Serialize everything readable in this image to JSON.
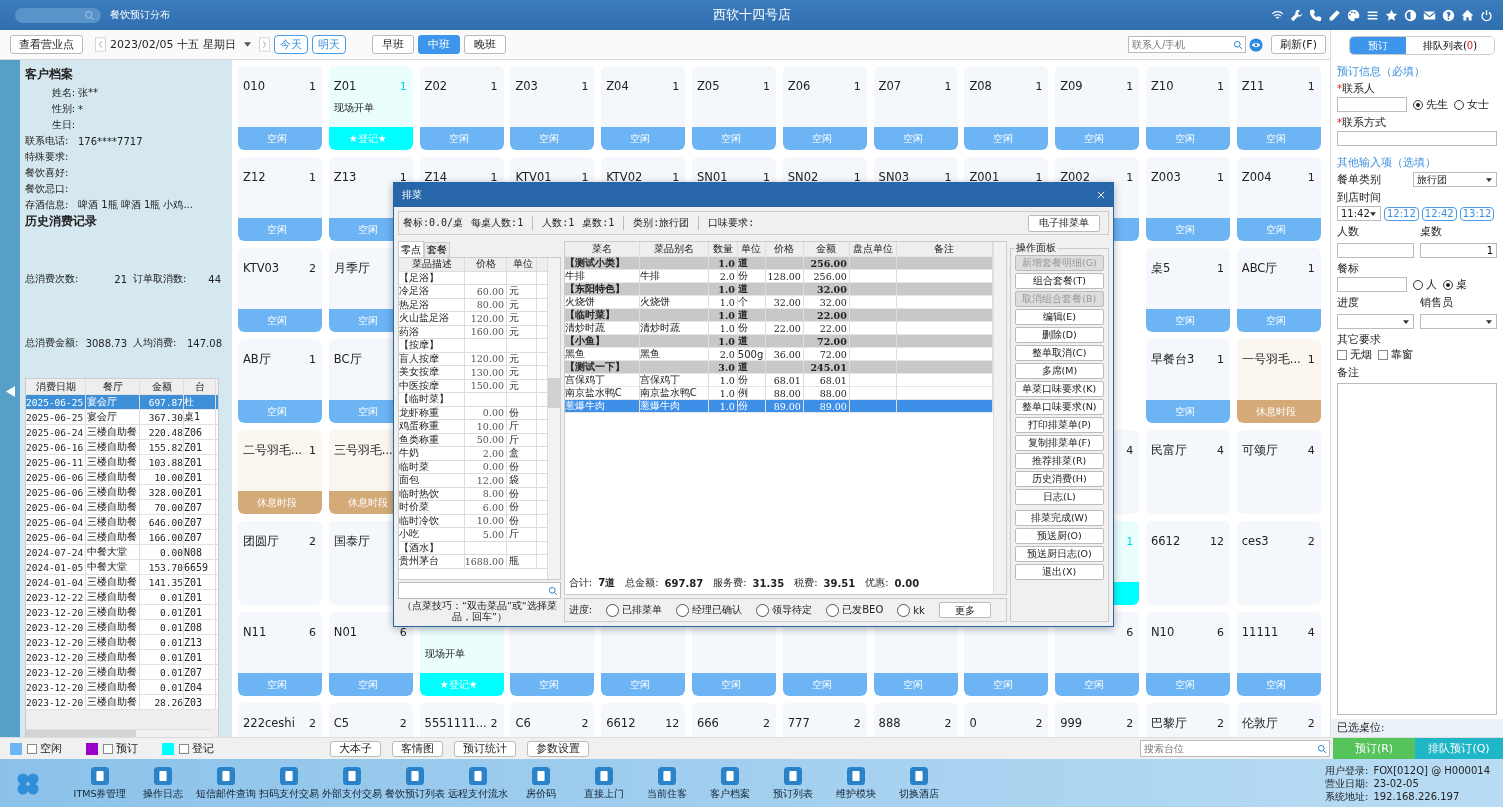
{
  "topbar": {
    "module": "餐饮预订分布",
    "title": "西软十四号店"
  },
  "toolbar": {
    "view_button": "查看营业点",
    "date": "2023/02/05",
    "lunar": "十五",
    "weekday": "星期日",
    "today": "今天",
    "tomorrow": "明天",
    "shifts": [
      {
        "label": "早班",
        "selected": false
      },
      {
        "label": "中班",
        "selected": true
      },
      {
        "label": "晚班",
        "selected": false
      }
    ],
    "search_placeholder": "联系人/手机",
    "refresh": "刷新(F)"
  },
  "customer": {
    "title": "客户档案",
    "fields": [
      {
        "label": "姓名:",
        "value": "张**"
      },
      {
        "label": "性别:",
        "value": "*"
      },
      {
        "label": "生日:"
      },
      {
        "label": "联系电话:",
        "value": "176****7717"
      },
      {
        "label": "特殊要求:"
      },
      {
        "label": "餐饮喜好:"
      },
      {
        "label": "餐饮忌口:"
      },
      {
        "label": "存酒信息:",
        "value": "啤酒 1瓶  啤酒 1瓶  小鸡..."
      }
    ],
    "history_title": "历史消费记录",
    "stats": [
      [
        {
          "label": "总消费次数:",
          "value": "21"
        },
        {
          "label": "订单取消数:",
          "value": "44"
        }
      ],
      [
        {
          "label": "总消费金额:",
          "value": "3088.73"
        },
        {
          "label": "人均消费:",
          "value": "147.08"
        }
      ]
    ],
    "history": {
      "columns": [
        "消费日期",
        "餐厅",
        "金额",
        "台"
      ],
      "rows": [
        {
          "date": "2025-06-25",
          "hall": "宴会厅",
          "amount": "697.87",
          "table": "杜",
          "selected": true
        },
        {
          "date": "2025-06-25",
          "hall": "宴会厅",
          "amount": "367.30",
          "table": "桌1",
          "selected": false
        },
        {
          "date": "2025-06-24",
          "hall": "三楼自助餐",
          "amount": "220.48",
          "table": "Z06",
          "selected": false
        },
        {
          "date": "2025-06-16",
          "hall": "三楼自助餐",
          "amount": "155.82",
          "table": "Z01",
          "selected": false
        },
        {
          "date": "2025-06-11",
          "hall": "三楼自助餐",
          "amount": "103.88",
          "table": "Z01",
          "selected": false
        },
        {
          "date": "2025-06-06",
          "hall": "三楼自助餐",
          "amount": "10.00",
          "table": "Z01",
          "selected": false
        },
        {
          "date": "2025-06-06",
          "hall": "三楼自助餐",
          "amount": "328.00",
          "table": "Z01",
          "selected": false
        },
        {
          "date": "2025-06-04",
          "hall": "三楼自助餐",
          "amount": "70.00",
          "table": "Z07",
          "selected": false
        },
        {
          "date": "2025-06-04",
          "hall": "三楼自助餐",
          "amount": "646.00",
          "table": "Z07",
          "selected": false
        },
        {
          "date": "2025-06-04",
          "hall": "三楼自助餐",
          "amount": "166.00",
          "table": "Z07",
          "selected": false
        },
        {
          "date": "2024-07-24",
          "hall": "中餐大堂",
          "amount": "0.00",
          "table": "N08",
          "selected": false
        },
        {
          "date": "2024-01-05",
          "hall": "中餐大堂",
          "amount": "153.70",
          "table": "6659",
          "selected": false
        },
        {
          "date": "2024-01-04",
          "hall": "三楼自助餐",
          "amount": "141.35",
          "table": "Z01",
          "selected": false
        },
        {
          "date": "2023-12-22",
          "hall": "三楼自助餐",
          "amount": "0.01",
          "table": "Z01",
          "selected": false
        },
        {
          "date": "2023-12-20",
          "hall": "三楼自助餐",
          "amount": "0.01",
          "table": "Z01",
          "selected": false
        },
        {
          "date": "2023-12-20",
          "hall": "三楼自助餐",
          "amount": "0.01",
          "table": "Z08",
          "selected": false
        },
        {
          "date": "2023-12-20",
          "hall": "三楼自助餐",
          "amount": "0.01",
          "table": "Z13",
          "selected": false
        },
        {
          "date": "2023-12-20",
          "hall": "三楼自助餐",
          "amount": "0.01",
          "table": "Z01",
          "selected": false
        },
        {
          "date": "2023-12-20",
          "hall": "三楼自助餐",
          "amount": "0.01",
          "table": "Z07",
          "selected": false
        },
        {
          "date": "2023-12-20",
          "hall": "三楼自助餐",
          "amount": "0.01",
          "table": "Z04",
          "selected": false
        },
        {
          "date": "2023-12-20",
          "hall": "三楼自助餐",
          "amount": "28.26",
          "table": "Z03",
          "selected": false
        }
      ]
    }
  },
  "tables": [
    {
      "label": "010",
      "count": "1",
      "status": {
        "kind": "free",
        "text": "空闲"
      }
    },
    {
      "label": "Z01",
      "count": "1",
      "note": "现场开单",
      "status": {
        "kind": "registered",
        "text": "★登记★"
      }
    },
    {
      "label": "Z02",
      "count": "1",
      "status": {
        "kind": "free",
        "text": "空闲"
      }
    },
    {
      "label": "Z03",
      "count": "1",
      "status": {
        "kind": "free",
        "text": "空闲"
      }
    },
    {
      "label": "Z04",
      "count": "1",
      "status": {
        "kind": "free",
        "text": "空闲"
      }
    },
    {
      "label": "Z05",
      "count": "1",
      "status": {
        "kind": "free",
        "text": "空闲"
      }
    },
    {
      "label": "Z06",
      "count": "1",
      "status": {
        "kind": "free",
        "text": "空闲"
      }
    },
    {
      "label": "Z07",
      "count": "1",
      "status": {
        "kind": "free",
        "text": "空闲"
      }
    },
    {
      "label": "Z08",
      "count": "1",
      "status": {
        "kind": "free",
        "text": "空闲"
      }
    },
    {
      "label": "Z09",
      "count": "1",
      "status": {
        "kind": "free",
        "text": "空闲"
      }
    },
    {
      "label": "Z10",
      "count": "1",
      "status": {
        "kind": "free",
        "text": "空闲"
      }
    },
    {
      "label": "Z11",
      "count": "1",
      "status": {
        "kind": "free",
        "text": "空闲"
      }
    },
    {
      "label": "Z12",
      "count": "1",
      "status": {
        "kind": "free",
        "text": "空闲"
      }
    },
    {
      "label": "Z13",
      "count": "1",
      "status": {
        "kind": "free",
        "text": "空闲"
      }
    },
    {
      "label": "Z14",
      "count": "1"
    },
    {
      "label": "KTV01",
      "count": "1"
    },
    {
      "label": "KTV02",
      "count": "1"
    },
    {
      "label": "SN01",
      "count": "1"
    },
    {
      "label": "SN02",
      "count": "1"
    },
    {
      "label": "SN03",
      "count": "1"
    },
    {
      "label": "Z001",
      "count": "1"
    },
    {
      "label": "Z002",
      "count": "1",
      "status": {
        "kind": "free"
      }
    },
    {
      "label": "Z003",
      "count": "1",
      "status": {
        "kind": "free",
        "text": "空闲"
      }
    },
    {
      "label": "Z004",
      "count": "1",
      "status": {
        "kind": "free",
        "text": "空闲"
      }
    },
    {
      "label": "KTV03",
      "count": "2",
      "status": {
        "kind": "free",
        "text": "空闲"
      }
    },
    {
      "label": "月季厅",
      "status": {
        "kind": "free",
        "text": "空闲"
      }
    },
    {
      "label": "桌5",
      "count": "1",
      "status": {
        "kind": "free",
        "text": "空闲"
      }
    },
    {
      "label": "ABC厅",
      "count": "1",
      "status": {
        "kind": "free",
        "text": "空闲"
      }
    },
    {
      "label": "AB厅",
      "count": "1",
      "status": {
        "kind": "free",
        "text": "空闲"
      }
    },
    {
      "label": "BC厅",
      "status": {
        "kind": "free",
        "text": "空闲"
      }
    },
    {
      "label": "早餐台3",
      "count": "1",
      "status": {
        "kind": "free",
        "text": "空闲"
      }
    },
    {
      "label": "一号羽毛...",
      "count": "1",
      "status": {
        "kind": "rest",
        "text": "休息时段"
      }
    },
    {
      "label": "二号羽毛...",
      "count": "1",
      "status": {
        "kind": "rest",
        "text": "休息时段"
      }
    },
    {
      "label": "三号羽毛...",
      "status": {
        "kind": "rest",
        "text": "休息时段"
      }
    },
    {
      "count": "4"
    },
    {
      "label": "民富厅",
      "count": "4"
    },
    {
      "label": "可颂厅",
      "count": "4"
    },
    {
      "label": "团圆厅",
      "count": "2"
    },
    {
      "label": "国泰厅"
    },
    {
      "count": "1",
      "status": {
        "kind": "registered"
      }
    },
    {
      "label": "6612",
      "count": "12"
    },
    {
      "label": "ces3",
      "count": "2"
    },
    {
      "label": "N11",
      "count": "6",
      "status": {
        "kind": "free",
        "text": "空闲"
      }
    },
    {
      "label": "N01",
      "count": "6",
      "status": {
        "kind": "free",
        "text": "空闲"
      }
    },
    {
      "note": "现场开单",
      "status": {
        "kind": "registered",
        "text": "★登记★"
      }
    },
    {
      "status": {
        "kind": "free",
        "text": "空闲"
      }
    },
    {
      "status": {
        "kind": "free",
        "text": "空闲"
      }
    },
    {
      "status": {
        "kind": "free",
        "text": "空闲"
      }
    },
    {
      "status": {
        "kind": "free",
        "text": "空闲"
      }
    },
    {
      "status": {
        "kind": "free",
        "text": "空闲"
      }
    },
    {
      "status": {
        "kind": "free",
        "text": "空闲"
      }
    },
    {
      "count": "6",
      "status": {
        "kind": "free",
        "text": "空闲"
      }
    },
    {
      "label": "N10",
      "count": "6",
      "status": {
        "kind": "free",
        "text": "空闲"
      }
    },
    {
      "label": "11111",
      "count": "4",
      "status": {
        "kind": "free",
        "text": "空闲"
      }
    },
    {
      "label": "222ceshi",
      "count": "2"
    },
    {
      "label": "C5",
      "count": "2"
    },
    {
      "label": "5551111...",
      "count": "2"
    },
    {
      "label": "C6",
      "count": "2"
    },
    {
      "label": "6612",
      "count": "12"
    },
    {
      "label": "666",
      "count": "2"
    },
    {
      "label": "777",
      "count": "2"
    },
    {
      "label": "888",
      "count": "2"
    },
    {
      "label": "0",
      "count": "2"
    },
    {
      "label": "999",
      "count": "2"
    },
    {
      "label": "巴黎厅",
      "count": "2"
    },
    {
      "label": "伦敦厅",
      "count": "2"
    }
  ],
  "reservation": {
    "tabs": [
      {
        "label": "预订",
        "selected": true
      },
      {
        "label": "排队列表",
        "count_open": "(",
        "count": "0",
        "count_close": ")",
        "selected": false
      }
    ],
    "required_title": "预订信息（必填）",
    "mark": "*",
    "contact_label": "联系人",
    "genders": [
      {
        "label": "先生",
        "selected": true
      },
      {
        "label": "女士",
        "selected": false
      }
    ],
    "phone_label": "联系方式",
    "optional_title": "其他输入项（选填）",
    "menu_type_label": "餐单类别",
    "menu_type": "旅行团",
    "arrival_label": "到店时间",
    "arrival": "11:42",
    "quick_times": [
      "12:12",
      "12:42",
      "13:12"
    ],
    "guests_label": "人数",
    "tables_label": "桌数",
    "tables_value": "1",
    "standard_label": "餐标",
    "standard_units": [
      {
        "label": "人",
        "selected": false
      },
      {
        "label": "桌",
        "selected": true
      }
    ],
    "progress_label": "进度",
    "sales_label": "销售员",
    "other_label": "其它要求",
    "options": [
      {
        "label": "无烟",
        "checked": false
      },
      {
        "label": "靠窗",
        "checked": false
      }
    ],
    "remark_label": "备注",
    "selected_tables_label": "已选桌位:"
  },
  "bottombar": {
    "legend": [
      {
        "label": "空闲",
        "color": "#6cb4f4",
        "checked": false
      },
      {
        "label": "预订",
        "color": "#9900cc",
        "checked": false
      },
      {
        "label": "登记",
        "color": "#00ffff",
        "checked": false
      }
    ],
    "buttons": [
      "大本子",
      "客情图",
      "预订统计",
      "参数设置"
    ],
    "search_placeholder": "搜索台位",
    "reserve": "预订(R)",
    "queue": "排队预订(Q)"
  },
  "taskbar": {
    "items": [
      "ITMS券管理",
      "操作日志",
      "短信邮件查询",
      "扫码支付交易",
      "外部支付交易",
      "餐饮预订列表",
      "远程支付流水",
      "房价码",
      "直接上门",
      "当前住客",
      "客户档案",
      "预订列表",
      "维护模块",
      "切换酒店"
    ],
    "status": [
      {
        "label": "用户登录:",
        "value": "FOX[012Q] @ H000014"
      },
      {
        "label": "营业日期:",
        "value": "23-02-05"
      },
      {
        "label": "系统地址:",
        "value": "192.168.226.197"
      }
    ]
  },
  "dialog": {
    "title": "排菜",
    "info_groups": [
      [
        "餐标:0.0/桌",
        "每桌人数:1"
      ],
      [
        "人数:1",
        "桌数:1"
      ],
      [
        "类别:旅行团"
      ],
      [
        "口味要求:"
      ]
    ],
    "e_menu": "电子排菜单",
    "tabs": [
      {
        "label": "零点",
        "selected": true
      },
      {
        "label": "套餐",
        "selected": false
      }
    ],
    "menu_columns": [
      "菜品描述",
      "价格",
      "单位"
    ],
    "menu": [
      {
        "kind": "category",
        "name": "【足浴】"
      },
      {
        "kind": "item",
        "name": "冷足浴",
        "price": "60.00",
        "unit": "元"
      },
      {
        "kind": "item",
        "name": "热足浴",
        "price": "80.00",
        "unit": "元"
      },
      {
        "kind": "item",
        "name": "火山盐足浴",
        "price": "120.00",
        "unit": "元"
      },
      {
        "kind": "item",
        "name": "药浴",
        "price": "160.00",
        "unit": "元"
      },
      {
        "kind": "category",
        "name": "【按摩】"
      },
      {
        "kind": "item",
        "name": "盲人按摩",
        "price": "120.00",
        "unit": "元"
      },
      {
        "kind": "item",
        "name": "美女按摩",
        "price": "130.00",
        "unit": "元"
      },
      {
        "kind": "item",
        "name": "中医按摩",
        "price": "150.00",
        "unit": "元"
      },
      {
        "kind": "category",
        "name": "【临时菜】"
      },
      {
        "kind": "item",
        "name": "龙虾称重",
        "price": "0.00",
        "unit": "份"
      },
      {
        "kind": "item",
        "name": "鸡蛋称重",
        "price": "10.00",
        "unit": "斤"
      },
      {
        "kind": "item",
        "name": "鱼类称重",
        "price": "50.00",
        "unit": "斤"
      },
      {
        "kind": "item",
        "name": "牛奶",
        "price": "2.00",
        "unit": "盒"
      },
      {
        "kind": "item",
        "name": "临时菜",
        "price": "0.00",
        "unit": "份"
      },
      {
        "kind": "item",
        "name": "面包",
        "price": "12.00",
        "unit": "袋"
      },
      {
        "kind": "item",
        "name": "临时热饮",
        "price": "8.00",
        "unit": "份"
      },
      {
        "kind": "item",
        "name": "时价菜",
        "price": "6.00",
        "unit": "份"
      },
      {
        "kind": "item",
        "name": "临时冷饮",
        "price": "10.00",
        "unit": "份"
      },
      {
        "kind": "item",
        "name": "小吃",
        "price": "5.00",
        "unit": "斤"
      },
      {
        "kind": "category",
        "name": "【酒水】"
      },
      {
        "kind": "item",
        "name": "贵州茅台",
        "price": "1688.00",
        "unit": "瓶"
      }
    ],
    "hint": "（点菜技巧：“双击菜品”或“选择菜品，回车”）",
    "order_columns": [
      "菜名",
      "菜品别名",
      "数量",
      "单位",
      "价格",
      "金额",
      "盘点单位",
      "备注"
    ],
    "order": [
      {
        "kind": "group",
        "name": "【测试小类】",
        "qty": "1.0",
        "unit": "道",
        "amount": "256.00",
        "selected": false
      },
      {
        "kind": "item",
        "name": "牛排",
        "alias": "牛排",
        "qty": "2.0",
        "unit": "份",
        "price": "128.00",
        "amount": "256.00",
        "selected": false
      },
      {
        "kind": "group",
        "name": "【东阳特色】",
        "qty": "1.0",
        "unit": "道",
        "amount": "32.00",
        "selected": false
      },
      {
        "kind": "item",
        "name": "火烧饼",
        "alias": "火烧饼",
        "qty": "1.0",
        "unit": "个",
        "price": "32.00",
        "amount": "32.00",
        "selected": false
      },
      {
        "kind": "group",
        "name": "【临时菜】",
        "qty": "1.0",
        "unit": "道",
        "amount": "22.00",
        "selected": false
      },
      {
        "kind": "item",
        "name": "清炒时蔬",
        "alias": "清炒时蔬",
        "qty": "1.0",
        "unit": "份",
        "price": "22.00",
        "amount": "22.00",
        "selected": false
      },
      {
        "kind": "group",
        "name": "【小鱼】",
        "qty": "1.0",
        "unit": "道",
        "amount": "72.00",
        "selected": false
      },
      {
        "kind": "item",
        "name": "黑鱼",
        "alias": "黑鱼",
        "qty": "2.0",
        "unit": "500g",
        "price": "36.00",
        "amount": "72.00",
        "selected": false
      },
      {
        "kind": "group",
        "name": "【测试一下】",
        "qty": "3.0",
        "unit": "道",
        "amount": "245.01",
        "selected": false
      },
      {
        "kind": "item",
        "name": "宫保鸡丁",
        "alias": "宫保鸡丁",
        "qty": "1.0",
        "unit": "份",
        "price": "68.01",
        "amount": "68.01",
        "selected": false
      },
      {
        "kind": "item",
        "name": "南京盐水鸭C",
        "alias": "南京盐水鸭C",
        "qty": "1.0",
        "unit": "例",
        "price": "88.00",
        "amount": "88.00",
        "selected": false
      },
      {
        "kind": "item",
        "name": "葱爆牛肉",
        "alias": "葱爆牛肉",
        "qty": "1.0",
        "unit": "份",
        "price": "89.00",
        "amount": "89.00",
        "selected": true
      }
    ],
    "totals": [
      {
        "label": "合计:",
        "value": "7道"
      },
      {
        "label": "总金额:",
        "value": "697.87"
      },
      {
        "label": "服务费:",
        "value": "31.35"
      },
      {
        "label": "税费:",
        "value": "39.51"
      },
      {
        "label": "优惠:",
        "value": "0.00"
      }
    ],
    "progress_label": "进度:",
    "progress": [
      {
        "label": "已排菜单",
        "selected": false
      },
      {
        "label": "经理已确认",
        "selected": false
      },
      {
        "label": "领导待定",
        "selected": false
      },
      {
        "label": "已发BEO",
        "selected": false
      },
      {
        "label": "kk",
        "selected": false
      }
    ],
    "more": "更多",
    "panel_title": "操作面板",
    "button_groups": [
      [
        {
          "label": "新增套餐明细(G)",
          "disabled": true
        },
        {
          "label": "组合套餐(T)",
          "disabled": false
        },
        {
          "label": "取消组合套餐(B)",
          "disabled": true
        },
        {
          "label": "编辑(E)",
          "disabled": false
        },
        {
          "label": "删除(D)",
          "disabled": false
        },
        {
          "label": "整单取消(C)",
          "disabled": false
        },
        {
          "label": "多席(M)",
          "disabled": false
        },
        {
          "label": "单菜口味要求(K)",
          "disabled": false
        },
        {
          "label": "整单口味要求(N)",
          "disabled": false
        },
        {
          "label": "打印排菜单(P)",
          "disabled": false
        },
        {
          "label": "复制排菜单(F)",
          "disabled": false
        },
        {
          "label": "推荐排菜(R)",
          "disabled": false
        },
        {
          "label": "历史消费(H)",
          "disabled": false
        },
        {
          "label": "日志(L)",
          "disabled": false
        }
      ],
      [
        {
          "label": "排菜完成(W)",
          "disabled": false
        },
        {
          "label": "预送厨(O)",
          "disabled": false
        },
        {
          "label": "预送厨日志(O)",
          "disabled": false
        },
        {
          "label": "退出(X)",
          "disabled": false
        }
      ]
    ]
  }
}
